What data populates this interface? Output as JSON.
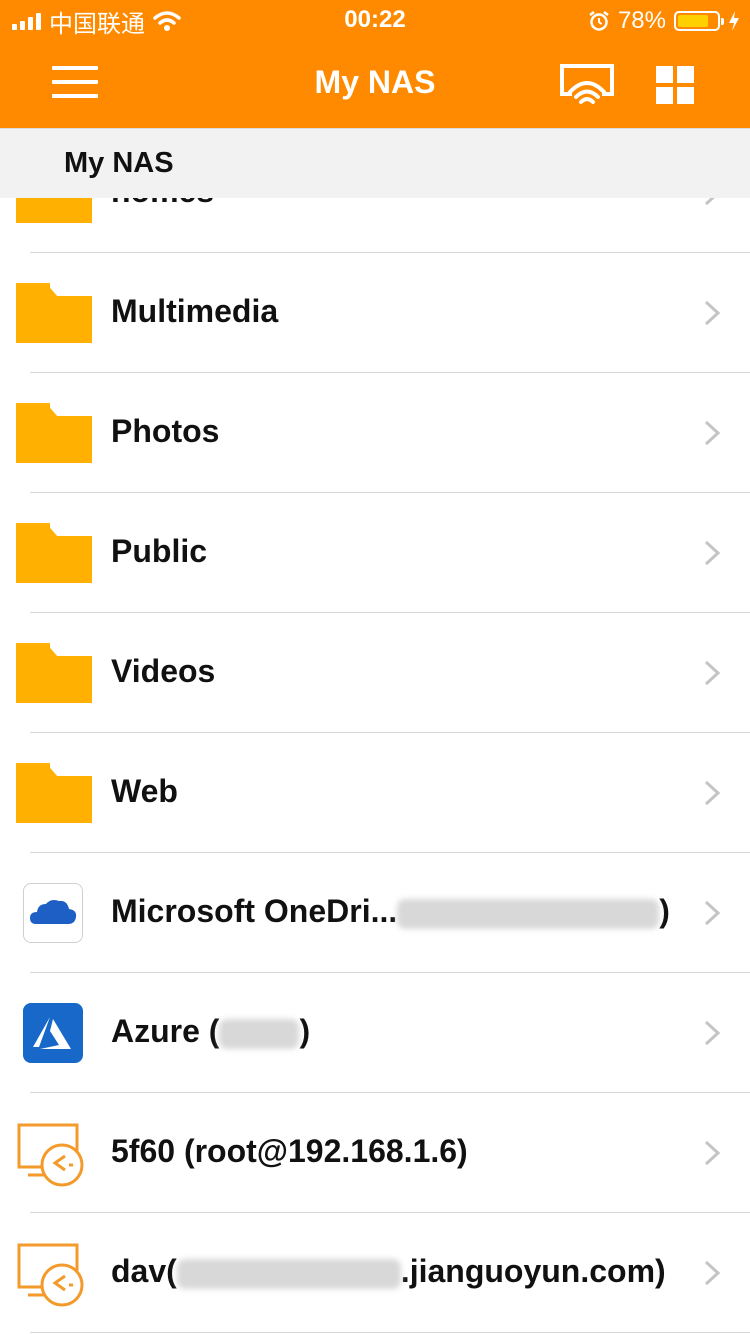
{
  "status_bar": {
    "carrier": "中国联通",
    "time": "00:22",
    "battery_percent": "78%",
    "battery_level": 0.78
  },
  "nav": {
    "title": "My NAS",
    "icons": [
      "menu-icon",
      "cast-icon",
      "grid-view-icon"
    ],
    "accent_color": "#ff8a00"
  },
  "breadcrumb": {
    "path": "My NAS"
  },
  "list": {
    "items": [
      {
        "type": "folder",
        "label": "homes"
      },
      {
        "type": "folder",
        "label": "Multimedia"
      },
      {
        "type": "folder",
        "label": "Photos"
      },
      {
        "type": "folder",
        "label": "Public"
      },
      {
        "type": "folder",
        "label": "Videos"
      },
      {
        "type": "folder",
        "label": "Web"
      },
      {
        "type": "onedrive",
        "label_prefix": "Microsoft OneDri...",
        "label_suffix": ")"
      },
      {
        "type": "azure",
        "label_prefix": "Azure (",
        "label_suffix": ")"
      },
      {
        "type": "remote",
        "label": "5f60 (root@192.168.1.6)"
      },
      {
        "type": "remote",
        "label_prefix": "dav(",
        "label_suffix": ".jianguoyun.com)"
      }
    ]
  },
  "colors": {
    "folder": "#ffb000",
    "remote_icon": "#f39a2b",
    "azure_tile": "#1768c8",
    "chevron": "#c4c4c4"
  }
}
